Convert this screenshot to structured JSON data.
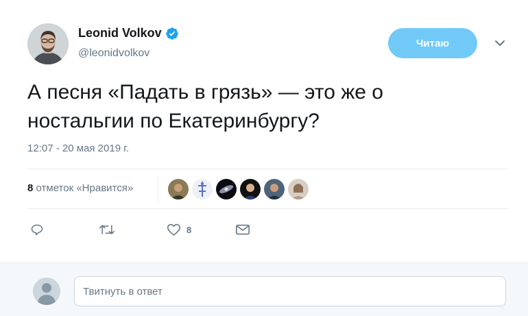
{
  "author": {
    "name": "Leonid Volkov",
    "handle": "@leonidvolkov",
    "verified": true
  },
  "follow_button": {
    "label": "Читаю"
  },
  "tweet": {
    "text_line1": "А песня «Падать в грязь» — это же о",
    "text_line2": "ностальгии по Екатеринбургу?",
    "timestamp": "12:07 - 20 мая 2019 г."
  },
  "likes": {
    "count": "8",
    "label": "отметок «Нравится»",
    "liker_icons": [
      "avatar-1",
      "avatar-2",
      "avatar-3",
      "avatar-4",
      "avatar-5",
      "avatar-6"
    ]
  },
  "actions": {
    "reply_icon": "reply-icon",
    "retweet_icon": "retweet-icon",
    "like_icon": "heart-icon",
    "like_count": "8",
    "dm_icon": "envelope-icon"
  },
  "reply": {
    "placeholder": "Твитнуть в ответ"
  },
  "colors": {
    "accent": "#71c9f8",
    "verified": "#1da1f2",
    "muted": "#657786"
  }
}
